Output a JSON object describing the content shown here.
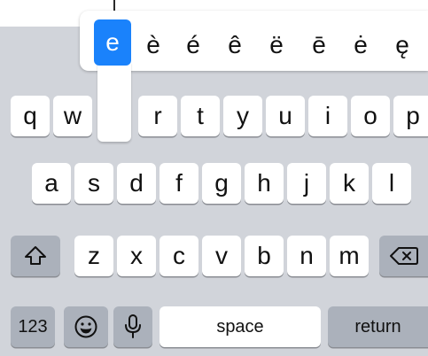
{
  "accent_popup": {
    "options": [
      "e",
      "è",
      "é",
      "ê",
      "ë",
      "ē",
      "ė",
      "ę"
    ],
    "selected": "e"
  },
  "rows": {
    "row1": [
      "q",
      "w",
      "e",
      "r",
      "t",
      "y",
      "u",
      "i",
      "o",
      "p"
    ],
    "row2": [
      "a",
      "s",
      "d",
      "f",
      "g",
      "h",
      "j",
      "k",
      "l"
    ],
    "row3": [
      "z",
      "x",
      "c",
      "v",
      "b",
      "n",
      "m"
    ]
  },
  "bottom_row": {
    "numbers_label": "123",
    "space_label": "space",
    "return_label": "return"
  },
  "icons": {
    "shift": "shift-icon",
    "delete": "delete-icon",
    "emoji": "emoji-icon",
    "dictation": "microphone-icon"
  },
  "colors": {
    "keyboard_background": "#d1d4da",
    "letter_key": "#ffffff",
    "function_key": "#abb1bb",
    "accent_selected": "#1a82fb"
  }
}
